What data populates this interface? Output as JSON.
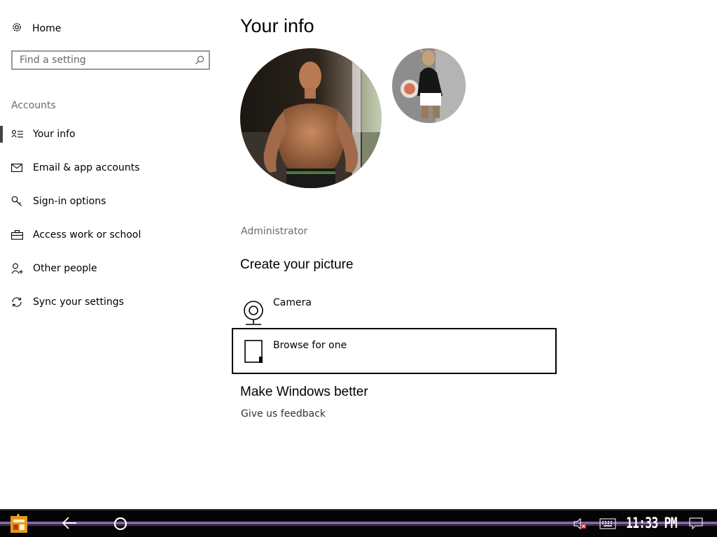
{
  "sidebar": {
    "home_label": "Home",
    "search": {
      "placeholder": "Find a setting",
      "value": ""
    },
    "section_label": "Accounts",
    "items": [
      {
        "label": "Your info",
        "icon": "person-list-icon",
        "active": true
      },
      {
        "label": "Email & app accounts",
        "icon": "mail-icon",
        "active": false
      },
      {
        "label": "Sign-in options",
        "icon": "key-icon",
        "active": false
      },
      {
        "label": "Access work or school",
        "icon": "briefcase-icon",
        "active": false
      },
      {
        "label": "Other people",
        "icon": "person-add-icon",
        "active": false
      },
      {
        "label": "Sync your settings",
        "icon": "sync-icon",
        "active": false
      }
    ]
  },
  "main": {
    "title": "Your info",
    "account_type": "Administrator",
    "create_picture": {
      "heading": "Create your picture",
      "options": [
        {
          "label": "Camera",
          "icon": "camera-icon"
        },
        {
          "label": "Browse for one",
          "icon": "document-icon",
          "focused": true
        }
      ]
    },
    "feedback": {
      "heading": "Make Windows better",
      "link": "Give us feedback"
    }
  },
  "taskbar": {
    "time": "11:33 PM",
    "icons": [
      "start-icon",
      "back-arrow-icon",
      "cortana-circle-icon",
      "volume-muted-icon",
      "keyboard-icon",
      "notifications-icon"
    ],
    "accent_color": "#8a63b0"
  },
  "colors": {
    "background": "#ffffff",
    "secondary_text": "#6b6b6b",
    "taskbar": "#050505"
  }
}
